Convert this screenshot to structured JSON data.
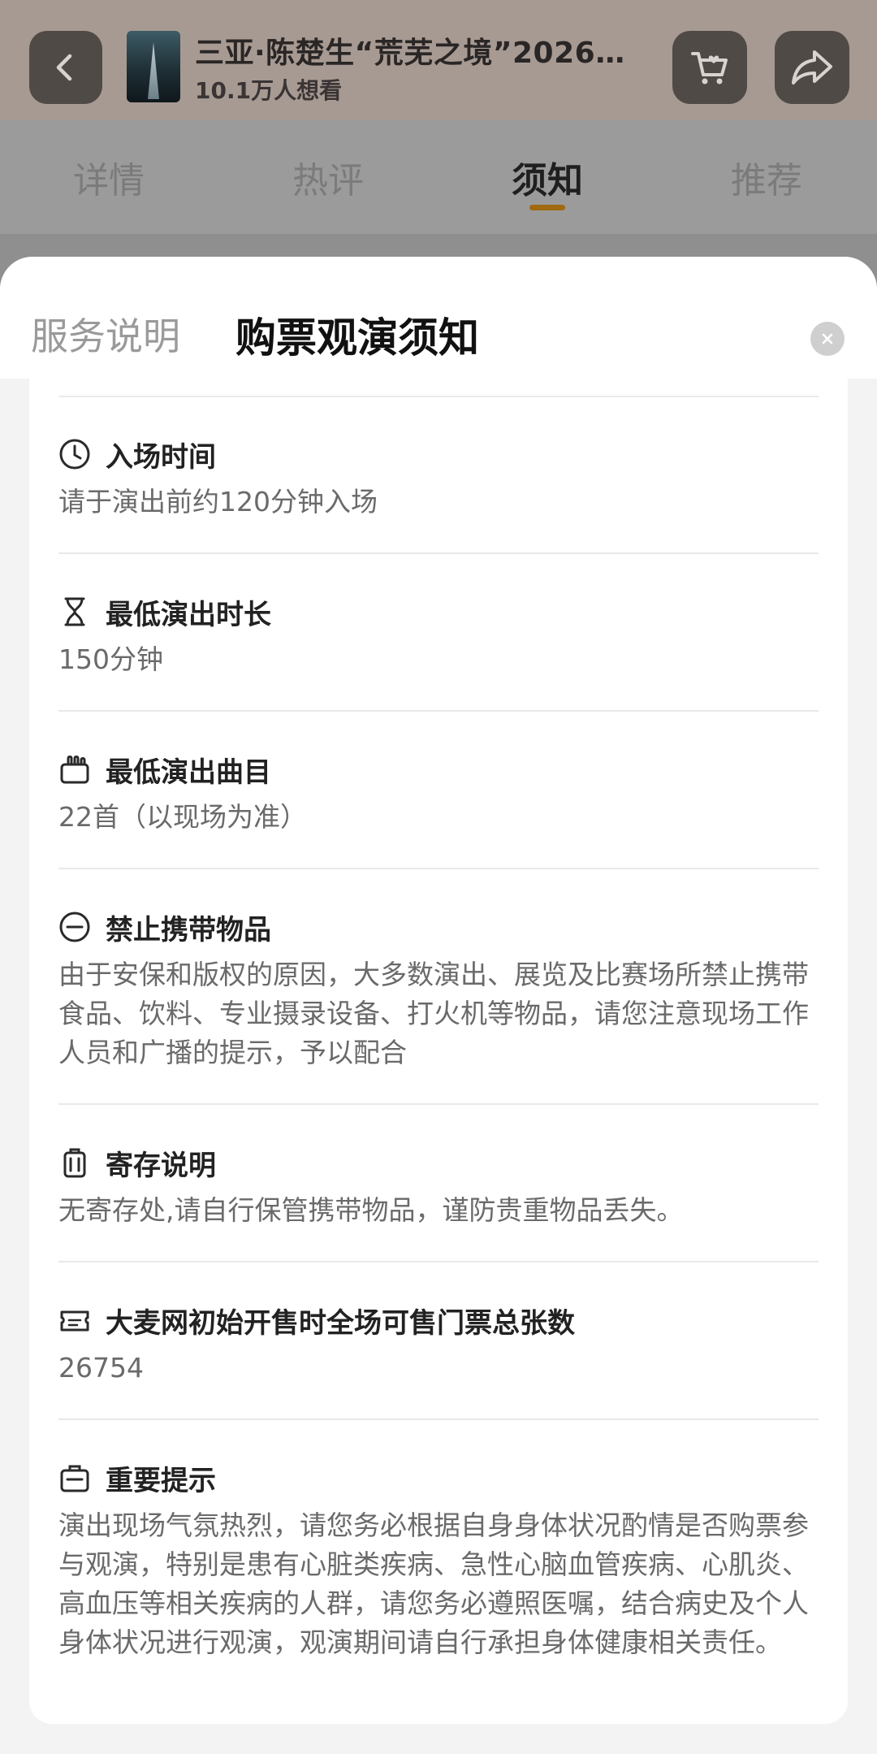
{
  "header": {
    "title": "三亚·陈楚生“荒芜之境”2026…",
    "subtitle": "10.1万人想看"
  },
  "tabs": [
    {
      "label": "详情"
    },
    {
      "label": "热评"
    },
    {
      "label": "须知",
      "active": true
    },
    {
      "label": "推荐"
    }
  ],
  "sheet": {
    "tab_service": "服务说明",
    "tab_notice": "购票观演须知",
    "items": [
      {
        "icon": "clock-icon",
        "label": "入场时间",
        "body": "请于演出前约120分钟入场"
      },
      {
        "icon": "hourglass-icon",
        "label": "最低演出时长",
        "body": "150分钟"
      },
      {
        "icon": "music-list-icon",
        "label": "最低演出曲目",
        "body": "22首（以现场为准）"
      },
      {
        "icon": "forbidden-icon",
        "label": "禁止携带物品",
        "body": "由于安保和版权的原因，大多数演出、展览及比赛场所禁止携带食品、饮料、专业摄录设备、打火机等物品，请您注意现场工作人员和广播的提示，予以配合"
      },
      {
        "icon": "luggage-icon",
        "label": "寄存说明",
        "body": "无寄存处,请自行保管携带物品，谨防贵重物品丢失。"
      },
      {
        "icon": "ticket-icon",
        "label": "大麦网初始开售时全场可售门票总张数",
        "body": "26754"
      },
      {
        "icon": "briefcase-icon",
        "label": "重要提示",
        "body": "演出现场气氛热烈，请您务必根据自身身体状况酌情是否购票参与观演，特别是患有心脏类疾病、急性心脑血管疾病、心肌炎、高血压等相关疾病的人群，请您务必遵照医嘱，结合病史及个人身体状况进行观演，观演期间请自行承担身体健康相关责任。"
      }
    ]
  },
  "colors": {
    "tab_underline": "#a06a10",
    "sheet_background": "#f3f3f3",
    "card_background": "#ffffff"
  }
}
